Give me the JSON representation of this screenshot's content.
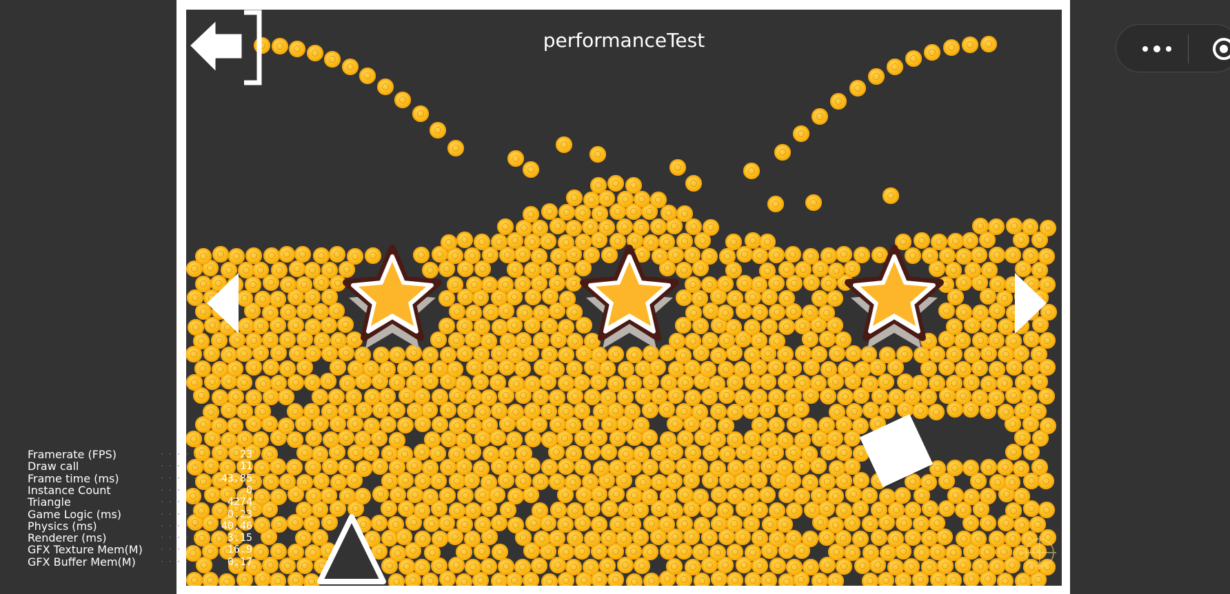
{
  "game": {
    "title": "performanceTest",
    "background_color": "#333333",
    "frame_color": "#ffffff",
    "coin_color": "#fbb917",
    "star_color": "#fdb629",
    "star_outline_color": "#4a1a14"
  },
  "controls": {
    "back_icon": "exit-arrow-icon",
    "prev_icon": "chevron-left-icon",
    "next_icon": "chevron-right-icon"
  },
  "capsule": {
    "more_icon": "more-dots-icon",
    "close_icon": "target-close-icon"
  },
  "stats": [
    {
      "label": "Framerate (FPS)",
      "value": "23"
    },
    {
      "label": "Draw call",
      "value": "11"
    },
    {
      "label": "Frame time (ms)",
      "value": "43.85"
    },
    {
      "label": "Instance Count",
      "value": "0"
    },
    {
      "label": "Triangle",
      "value": "4274"
    },
    {
      "label": "Game Logic (ms)",
      "value": "0.23"
    },
    {
      "label": "Physics (ms)",
      "value": "40.46"
    },
    {
      "label": "Renderer (ms)",
      "value": "3.15"
    },
    {
      "label": "GFX Texture Mem(M)",
      "value": "16.9"
    },
    {
      "label": "GFX Buffer Mem(M)",
      "value": "0.17"
    }
  ]
}
